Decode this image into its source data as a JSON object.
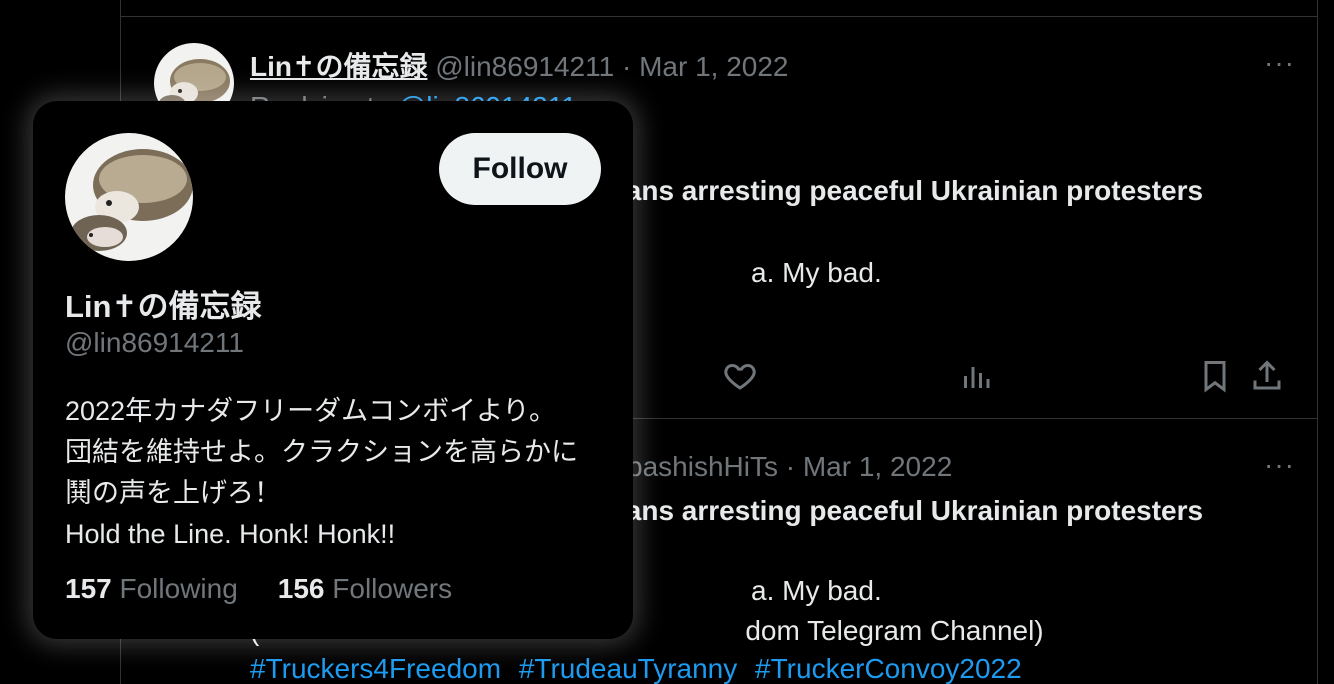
{
  "colors": {
    "background": "#000000",
    "text": "#e7e9ea",
    "muted": "#71767b",
    "link": "#1d9bf0",
    "follow_bg": "#eff3f4"
  },
  "tweet1": {
    "name": "Lin✝の備忘録",
    "handle": "@lin86914211",
    "dot": "·",
    "date": "Mar 1, 2022",
    "more": "···",
    "reply_prefix": "Replying to",
    "reply_handle": "@lin86914211",
    "bold_fragment": "ians arresting peaceful Ukrainian protesters",
    "text_fragment": "a. My bad.",
    "actions": [
      "heart-icon",
      "views-icon",
      "bookmark-icon",
      "share-icon"
    ]
  },
  "tweet2": {
    "handle_fragment": "bashishHiTs",
    "dot": "·",
    "date": "Mar 1, 2022",
    "more": "···",
    "bold_fragment": "ians arresting peaceful Ukrainian protesters",
    "text_fragment": "a. My bad.",
    "channel_fragment": "(",
    "channel_end": "dom Telegram Channel)",
    "hashtags": [
      "#Truckers4Freedom",
      "#TrudeauTyranny",
      "#TruckerConvoy2022"
    ]
  },
  "hover_card": {
    "follow_label": "Follow",
    "name": "Lin✝の備忘録",
    "handle": "@lin86914211",
    "bio": [
      "2022年カナダフリーダムコンボイより。",
      "団結を維持せよ。クラクションを高らかに",
      "鬨の声を上げろ！",
      "Hold the Line.  Honk! Honk!!"
    ],
    "following_count": "157",
    "following_label": "Following",
    "followers_count": "156",
    "followers_label": "Followers"
  }
}
